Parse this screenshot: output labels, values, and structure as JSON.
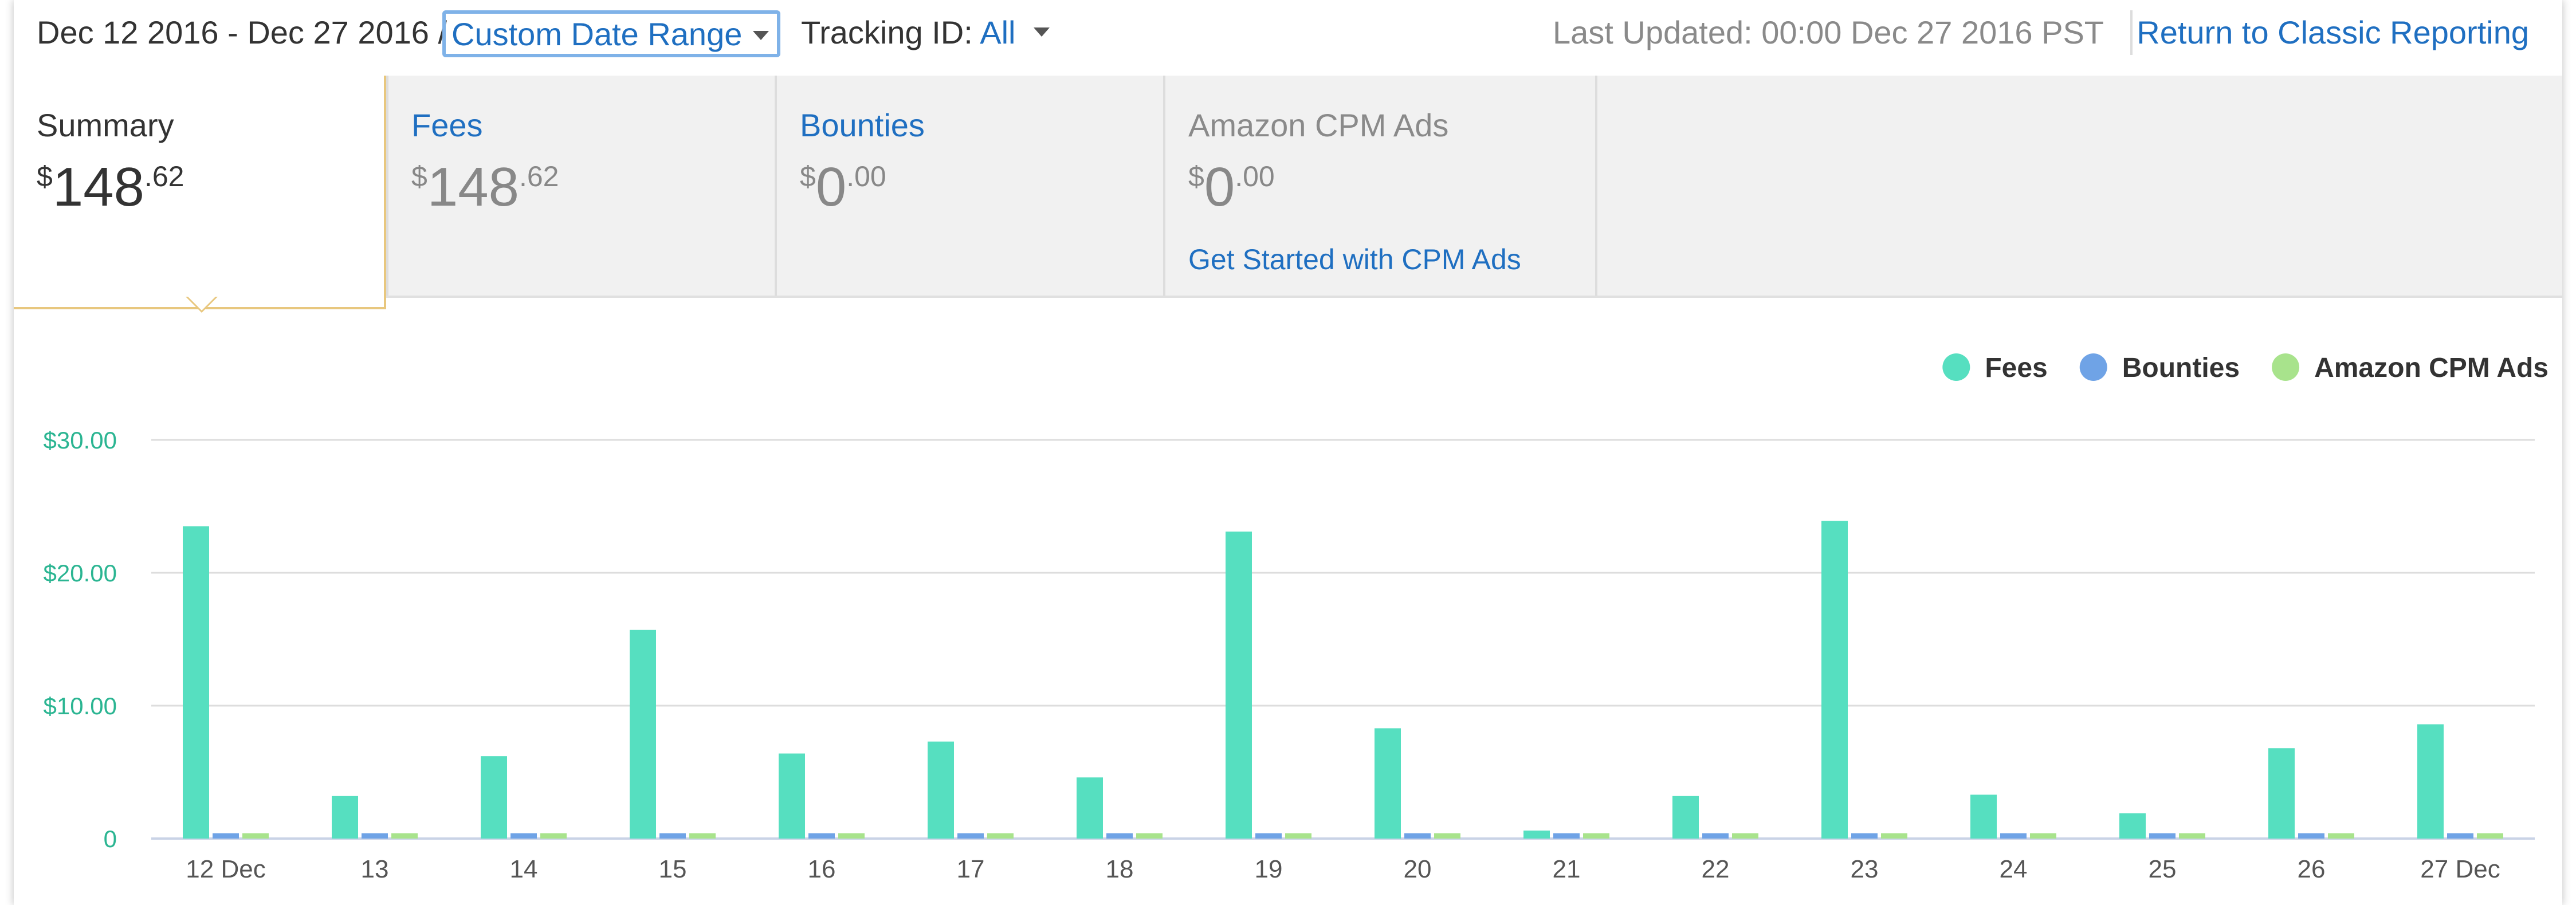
{
  "header": {
    "date_range": "Dec 12 2016 - Dec 27 2016 /",
    "range_select": "Custom Date Range",
    "tracking_label": "Tracking ID:",
    "tracking_value": "All",
    "last_updated": "Last Updated: 00:00 Dec 27 2016 PST",
    "classic_link": "Return to Classic Reporting"
  },
  "tabs": [
    {
      "title": "Summary",
      "currency": "$",
      "whole": "148",
      "cents": ".62"
    },
    {
      "title": "Fees",
      "currency": "$",
      "whole": "148",
      "cents": ".62"
    },
    {
      "title": "Bounties",
      "currency": "$",
      "whole": "0",
      "cents": ".00"
    },
    {
      "title": "Amazon CPM Ads",
      "currency": "$",
      "whole": "0",
      "cents": ".00",
      "link": "Get Started with CPM Ads"
    }
  ],
  "colors": {
    "fees": "#56dfc0",
    "bounties": "#6fa3e6",
    "cpm": "#a8e38c",
    "link": "#1f6fc1",
    "accent_border": "#e8c77e",
    "y_axis_text": "#2bb592"
  },
  "chart_data": {
    "type": "bar",
    "categories": [
      "12 Dec",
      "13",
      "14",
      "15",
      "16",
      "17",
      "18",
      "19",
      "20",
      "21",
      "22",
      "23",
      "24",
      "25",
      "26",
      "27 Dec"
    ],
    "series": [
      {
        "name": "Fees",
        "values": [
          23.5,
          3.2,
          6.2,
          15.7,
          6.4,
          7.3,
          4.6,
          23.1,
          8.3,
          0.6,
          3.2,
          23.9,
          3.3,
          1.9,
          6.8,
          8.6
        ]
      },
      {
        "name": "Bounties",
        "values": [
          0.4,
          0.4,
          0.4,
          0.4,
          0.4,
          0.4,
          0.4,
          0.4,
          0.4,
          0.4,
          0.4,
          0.4,
          0.4,
          0.4,
          0.4,
          0.4
        ]
      },
      {
        "name": "Amazon CPM Ads",
        "values": [
          0.4,
          0.4,
          0.4,
          0.4,
          0.4,
          0.4,
          0.4,
          0.4,
          0.4,
          0.4,
          0.4,
          0.4,
          0.4,
          0.4,
          0.4,
          0.4
        ]
      }
    ],
    "y_ticks": [
      "0",
      "$10.00",
      "$20.00",
      "$30.00"
    ],
    "ylim": [
      0,
      30
    ],
    "grid": true,
    "legend_position": "top-right"
  }
}
